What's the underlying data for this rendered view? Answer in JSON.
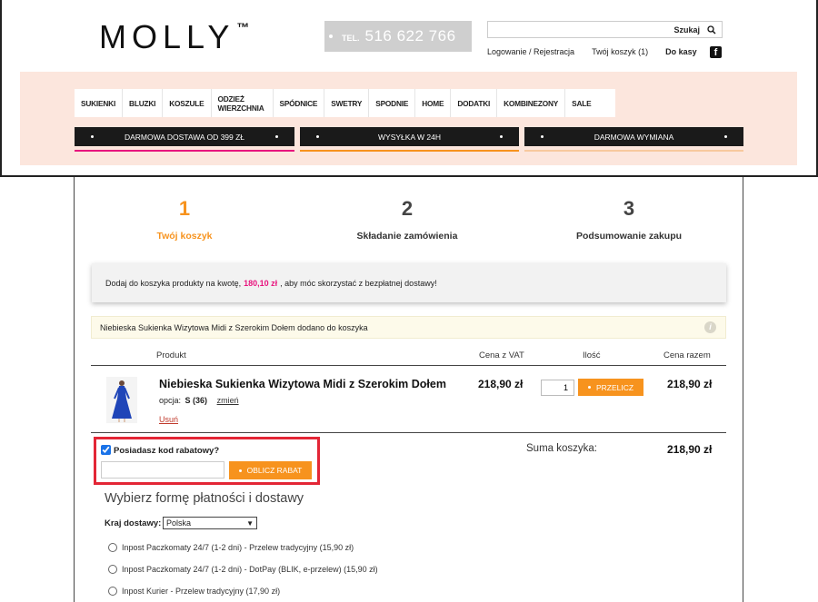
{
  "header": {
    "logo": "MOLLY",
    "logo_tm": "™",
    "phone_label": "TEL.",
    "phone_number": "516 622 766",
    "search_label": "Szukaj",
    "search_placeholder": "",
    "login_link": "Logowanie / Rejestracja",
    "cart_link": "Twój koszyk (1)",
    "checkout_link": "Do kasy",
    "facebook_icon": "facebook-icon"
  },
  "nav": {
    "items": [
      "SUKIENKI",
      "BLUZKI",
      "KOSZULE",
      "ODZIEŻ WIERZCHNIA",
      "SPÓDNICE",
      "SWETRY",
      "SPODNIE",
      "HOME",
      "DODATKI",
      "KOMBINEZONY",
      "SALE"
    ]
  },
  "promos": [
    {
      "text": "DARMOWA DOSTAWA OD 399 ZŁ",
      "underline_color": "#e8157e"
    },
    {
      "text": "WYSYŁKA W 24H",
      "underline_color": "#f7931e"
    },
    {
      "text": "DARMOWA WYMIANA",
      "underline_color": "#f7c99e"
    }
  ],
  "steps": [
    {
      "number": "1",
      "label": "Twój koszyk"
    },
    {
      "number": "2",
      "label": "Składanie zamówienia"
    },
    {
      "number": "3",
      "label": "Podsumowanie zakupu"
    }
  ],
  "notice": {
    "before": "Dodaj do koszyka produkty na kwotę,",
    "amount": "180,10 zł",
    "after": ", aby móc skorzystać z bezpłatnej dostawy!"
  },
  "added_message": "Niebieska Sukienka Wizytowa Midi z Szerokim Dołem dodano do koszyka",
  "table": {
    "headers": {
      "product": "Produkt",
      "price": "Cena z VAT",
      "qty": "Ilość",
      "total": "Cena razem"
    },
    "item": {
      "name": "Niebieska Sukienka Wizytowa Midi z Szerokim Dołem",
      "option_label": "opcja:",
      "option_value": "S (36)",
      "change_link": "zmień",
      "remove_link": "Usuń",
      "price": "218,90 zł",
      "quantity": "1",
      "recalc_button": "PRZELICZ",
      "total": "218,90 zł"
    }
  },
  "discount": {
    "label": "Posiadasz kod rabatowy?",
    "checked": true,
    "input_value": "",
    "button": "OBLICZ RABAT"
  },
  "summary": {
    "label": "Suma koszyka:",
    "value": "218,90 zł"
  },
  "payment": {
    "title": "Wybierz formę płatności i dostawy",
    "country_label": "Kraj dostawy:",
    "country_value": "Polska",
    "options": [
      "Inpost Paczkomaty 24/7 (1-2 dni) - Przelew tradycyjny (15,90 zł)",
      "Inpost Paczkomaty 24/7 (1-2 dni) - DotPay (BLIK, e-przelew) (15,90 zł)",
      "Inpost Kurier - Przelew tradycyjny (17,90 zł)"
    ]
  },
  "colors": {
    "accent": "#f7931e",
    "pink": "#e8157e",
    "band": "#fce6dd",
    "highlight": "#e32636"
  }
}
